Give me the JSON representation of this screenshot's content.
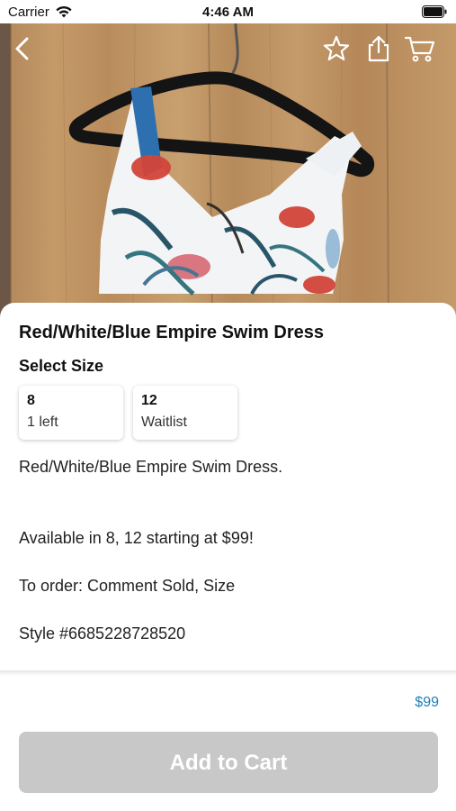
{
  "status_bar": {
    "carrier": "Carrier",
    "time": "4:46 AM",
    "icons": [
      "wifi-icon",
      "battery-icon"
    ]
  },
  "nav": {
    "icons": [
      "back-icon",
      "star-icon",
      "share-icon",
      "cart-icon"
    ]
  },
  "product": {
    "title": "Red/White/Blue Empire Swim Dress",
    "select_size_label": "Select Size",
    "sizes": [
      {
        "size": "8",
        "note": "1 left"
      },
      {
        "size": "12",
        "note": "Waitlist"
      }
    ],
    "description": [
      "Red/White/Blue Empire Swim Dress.",
      "Available in 8, 12 starting at $99!",
      "To order: Comment Sold, Size",
      "Style #6685228728520"
    ],
    "price": "$99",
    "add_to_cart_label": "Add to Cart"
  },
  "colors": {
    "price": "#1f7fb6",
    "button_disabled": "#c8c8c8"
  }
}
